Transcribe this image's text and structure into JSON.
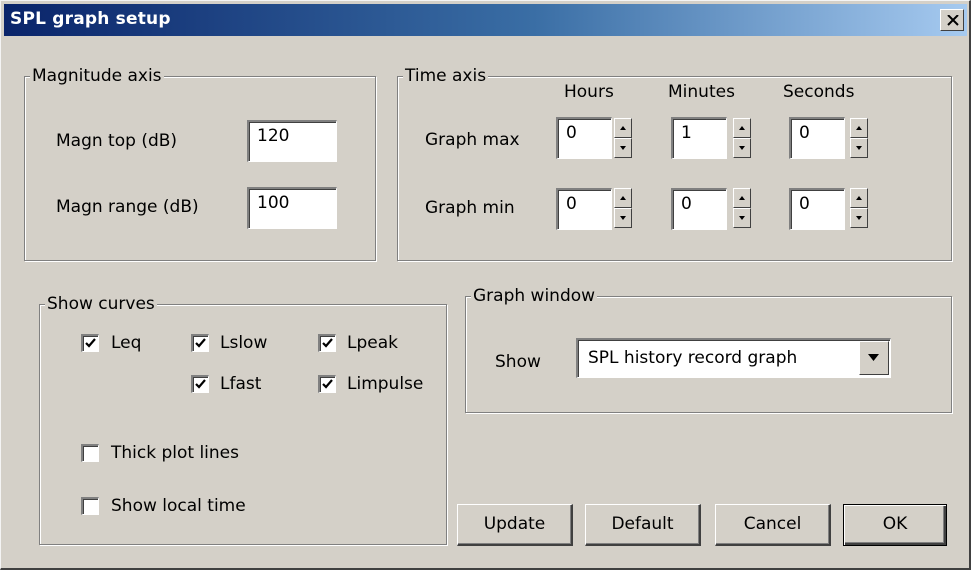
{
  "window": {
    "title": "SPL graph setup"
  },
  "magnitude": {
    "legend": "Magnitude axis",
    "top_label": "Magn top (dB)",
    "top_value": "120",
    "range_label": "Magn range (dB)",
    "range_value": "100"
  },
  "time": {
    "legend": "Time axis",
    "col_hours": "Hours",
    "col_minutes": "Minutes",
    "col_seconds": "Seconds",
    "max_label": "Graph max",
    "max_hours": "0",
    "max_minutes": "1",
    "max_seconds": "0",
    "min_label": "Graph min",
    "min_hours": "0",
    "min_minutes": "0",
    "min_seconds": "0"
  },
  "curves": {
    "legend": "Show curves",
    "leq": {
      "label": "Leq",
      "checked": true
    },
    "lslow": {
      "label": "Lslow",
      "checked": true
    },
    "lpeak": {
      "label": "Lpeak",
      "checked": true
    },
    "lfast": {
      "label": "Lfast",
      "checked": true
    },
    "limpulse": {
      "label": "Limpulse",
      "checked": true
    },
    "thick": {
      "label": "Thick plot lines",
      "checked": false
    },
    "localtime": {
      "label": "Show local time",
      "checked": false
    }
  },
  "graph_window": {
    "legend": "Graph window",
    "show_label": "Show",
    "selected": "SPL history record graph"
  },
  "buttons": {
    "update": "Update",
    "default": "Default",
    "cancel": "Cancel",
    "ok": "OK"
  }
}
